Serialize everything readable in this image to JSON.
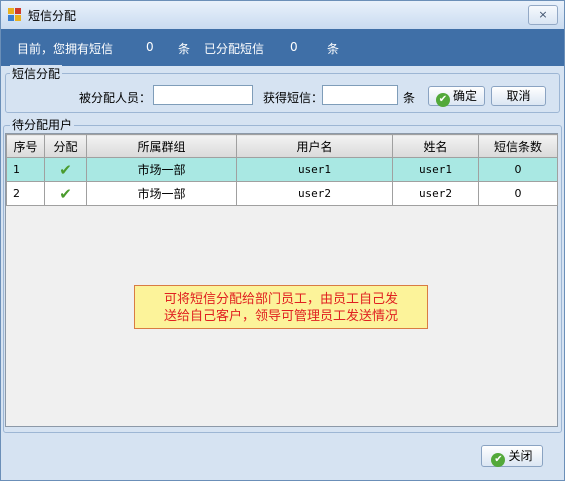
{
  "window": {
    "title": "短信分配",
    "close_glyph": "×"
  },
  "info": {
    "have_label": "目前，您拥有短信",
    "have_count": "0",
    "unit1": "条",
    "assigned_label": "已分配短信",
    "assigned_count": "0",
    "unit2": "条"
  },
  "assign": {
    "group_title": "短信分配",
    "assignee_label": "被分配人员：",
    "assignee_value": "",
    "sms_label": "获得短信：",
    "sms_value": "",
    "unit": "条",
    "confirm_label": "确定",
    "cancel_label": "取消"
  },
  "users": {
    "group_title": "待分配用户",
    "columns": [
      "序号",
      "分配",
      "所属群组",
      "用户名",
      "姓名",
      "短信条数"
    ],
    "rows": [
      {
        "index": "1",
        "assigned_icon": "check-icon",
        "group": "市场一部",
        "username": "user1",
        "name": "user1",
        "sms_count": "0"
      },
      {
        "index": "2",
        "assigned_icon": "check-icon",
        "group": "市场一部",
        "username": "user2",
        "name": "user2",
        "sms_count": "0"
      }
    ]
  },
  "tooltip": {
    "line1": "可将短信分配给部门员工，由员工自己发",
    "line2": "送给自己客户，领导可管理员工发送情况"
  },
  "footer": {
    "close_label": "关闭"
  },
  "colors": {
    "info_bar": "#3f6fa7",
    "selected_row": "#a9e8e3",
    "tooltip_bg": "#fcf39a",
    "tooltip_text": "#e02020",
    "check": "#4a9b2d"
  }
}
